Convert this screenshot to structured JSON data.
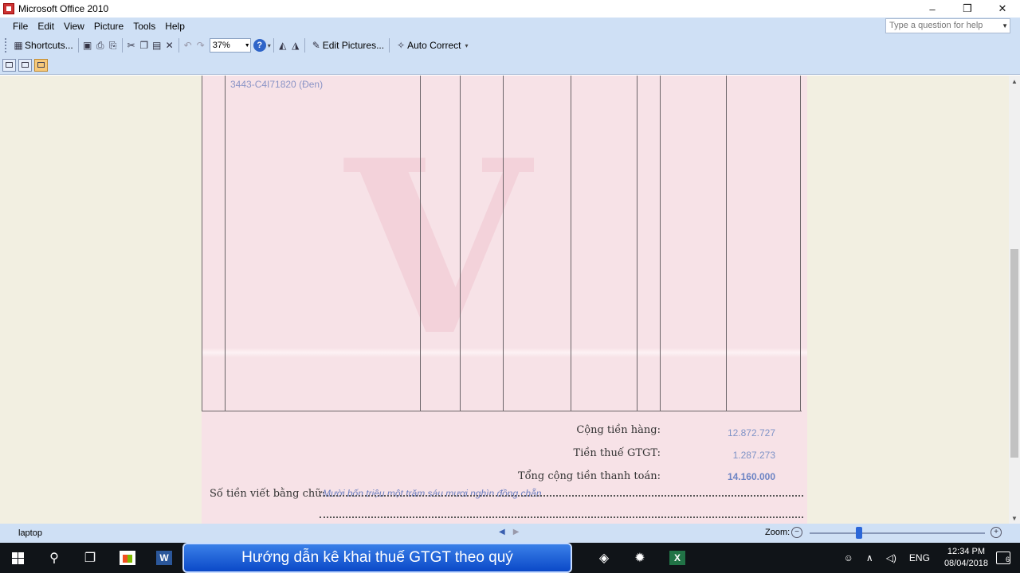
{
  "window": {
    "title": "Microsoft Office 2010",
    "controls": {
      "minimize": "–",
      "restore": "❒",
      "close": "✕"
    }
  },
  "menu": {
    "items": [
      "File",
      "Edit",
      "View",
      "Picture",
      "Tools",
      "Help"
    ],
    "help_placeholder": "Type a question for help"
  },
  "toolbar": {
    "shortcuts_label": "Shortcuts...",
    "zoom_value": "37%",
    "edit_pictures_label": "Edit Pictures...",
    "auto_correct_label": "Auto Correct"
  },
  "document": {
    "product_code": "3443-C4I71820 (Đen)",
    "subtotal_label": "Cộng tiền hàng:",
    "subtotal_value": "12.872.727",
    "vat_label": "Tiền thuế GTGT:",
    "vat_value": "1.287.273",
    "total_label": "Tổng cộng tiền thanh toán:",
    "total_value": "14.160.000",
    "words_label": "Số tiền viết bằng chữ:",
    "words_value": "Mười bốn triệu một trăm sáu mươi nghìn đồng chẵn"
  },
  "statusbar": {
    "filename": "laptop",
    "zoom_label": "Zoom:",
    "zoom_level": 0.28
  },
  "taskbar": {
    "banner_text": "Hướng dẫn kê khai thuế GTGT theo quý",
    "language": "ENG",
    "time": "12:34 PM",
    "date": "08/04/2018",
    "notification_count": "6"
  }
}
